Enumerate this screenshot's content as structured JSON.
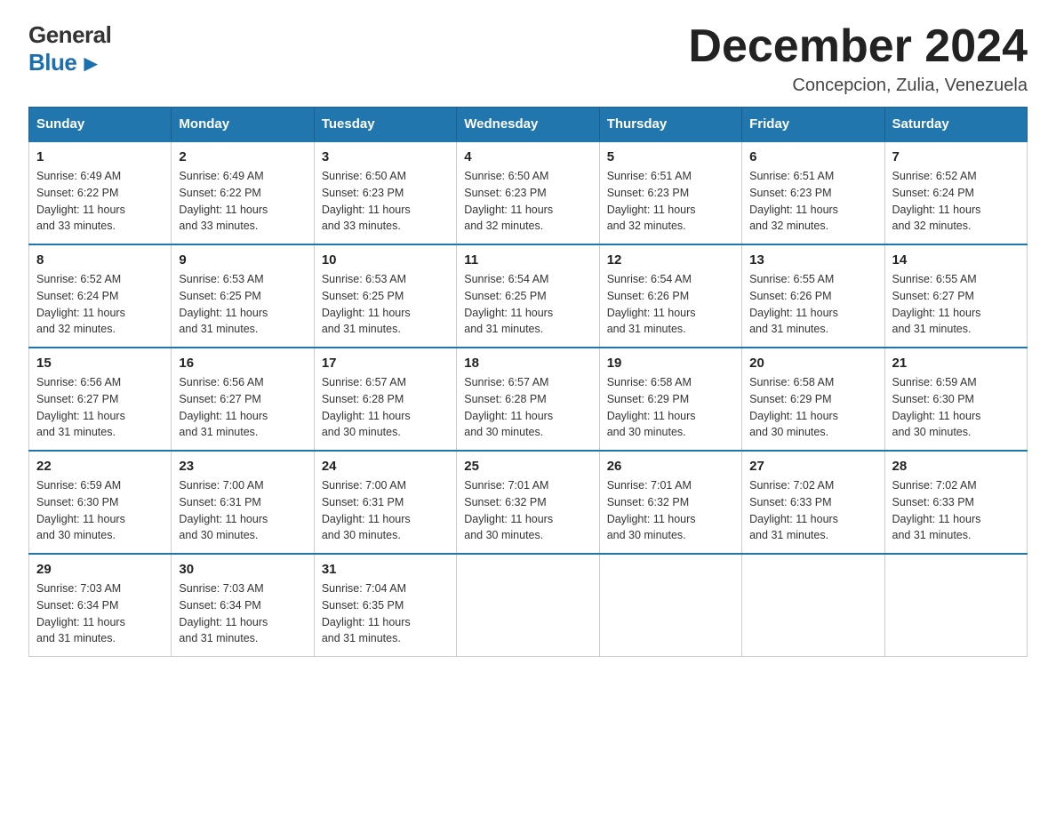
{
  "logo": {
    "general": "General",
    "blue": "Blue"
  },
  "header": {
    "month_year": "December 2024",
    "location": "Concepcion, Zulia, Venezuela"
  },
  "weekdays": [
    "Sunday",
    "Monday",
    "Tuesday",
    "Wednesday",
    "Thursday",
    "Friday",
    "Saturday"
  ],
  "weeks": [
    [
      {
        "day": "1",
        "sunrise": "6:49 AM",
        "sunset": "6:22 PM",
        "daylight": "11 hours and 33 minutes."
      },
      {
        "day": "2",
        "sunrise": "6:49 AM",
        "sunset": "6:22 PM",
        "daylight": "11 hours and 33 minutes."
      },
      {
        "day": "3",
        "sunrise": "6:50 AM",
        "sunset": "6:23 PM",
        "daylight": "11 hours and 33 minutes."
      },
      {
        "day": "4",
        "sunrise": "6:50 AM",
        "sunset": "6:23 PM",
        "daylight": "11 hours and 32 minutes."
      },
      {
        "day": "5",
        "sunrise": "6:51 AM",
        "sunset": "6:23 PM",
        "daylight": "11 hours and 32 minutes."
      },
      {
        "day": "6",
        "sunrise": "6:51 AM",
        "sunset": "6:23 PM",
        "daylight": "11 hours and 32 minutes."
      },
      {
        "day": "7",
        "sunrise": "6:52 AM",
        "sunset": "6:24 PM",
        "daylight": "11 hours and 32 minutes."
      }
    ],
    [
      {
        "day": "8",
        "sunrise": "6:52 AM",
        "sunset": "6:24 PM",
        "daylight": "11 hours and 32 minutes."
      },
      {
        "day": "9",
        "sunrise": "6:53 AM",
        "sunset": "6:25 PM",
        "daylight": "11 hours and 31 minutes."
      },
      {
        "day": "10",
        "sunrise": "6:53 AM",
        "sunset": "6:25 PM",
        "daylight": "11 hours and 31 minutes."
      },
      {
        "day": "11",
        "sunrise": "6:54 AM",
        "sunset": "6:25 PM",
        "daylight": "11 hours and 31 minutes."
      },
      {
        "day": "12",
        "sunrise": "6:54 AM",
        "sunset": "6:26 PM",
        "daylight": "11 hours and 31 minutes."
      },
      {
        "day": "13",
        "sunrise": "6:55 AM",
        "sunset": "6:26 PM",
        "daylight": "11 hours and 31 minutes."
      },
      {
        "day": "14",
        "sunrise": "6:55 AM",
        "sunset": "6:27 PM",
        "daylight": "11 hours and 31 minutes."
      }
    ],
    [
      {
        "day": "15",
        "sunrise": "6:56 AM",
        "sunset": "6:27 PM",
        "daylight": "11 hours and 31 minutes."
      },
      {
        "day": "16",
        "sunrise": "6:56 AM",
        "sunset": "6:27 PM",
        "daylight": "11 hours and 31 minutes."
      },
      {
        "day": "17",
        "sunrise": "6:57 AM",
        "sunset": "6:28 PM",
        "daylight": "11 hours and 30 minutes."
      },
      {
        "day": "18",
        "sunrise": "6:57 AM",
        "sunset": "6:28 PM",
        "daylight": "11 hours and 30 minutes."
      },
      {
        "day": "19",
        "sunrise": "6:58 AM",
        "sunset": "6:29 PM",
        "daylight": "11 hours and 30 minutes."
      },
      {
        "day": "20",
        "sunrise": "6:58 AM",
        "sunset": "6:29 PM",
        "daylight": "11 hours and 30 minutes."
      },
      {
        "day": "21",
        "sunrise": "6:59 AM",
        "sunset": "6:30 PM",
        "daylight": "11 hours and 30 minutes."
      }
    ],
    [
      {
        "day": "22",
        "sunrise": "6:59 AM",
        "sunset": "6:30 PM",
        "daylight": "11 hours and 30 minutes."
      },
      {
        "day": "23",
        "sunrise": "7:00 AM",
        "sunset": "6:31 PM",
        "daylight": "11 hours and 30 minutes."
      },
      {
        "day": "24",
        "sunrise": "7:00 AM",
        "sunset": "6:31 PM",
        "daylight": "11 hours and 30 minutes."
      },
      {
        "day": "25",
        "sunrise": "7:01 AM",
        "sunset": "6:32 PM",
        "daylight": "11 hours and 30 minutes."
      },
      {
        "day": "26",
        "sunrise": "7:01 AM",
        "sunset": "6:32 PM",
        "daylight": "11 hours and 30 minutes."
      },
      {
        "day": "27",
        "sunrise": "7:02 AM",
        "sunset": "6:33 PM",
        "daylight": "11 hours and 31 minutes."
      },
      {
        "day": "28",
        "sunrise": "7:02 AM",
        "sunset": "6:33 PM",
        "daylight": "11 hours and 31 minutes."
      }
    ],
    [
      {
        "day": "29",
        "sunrise": "7:03 AM",
        "sunset": "6:34 PM",
        "daylight": "11 hours and 31 minutes."
      },
      {
        "day": "30",
        "sunrise": "7:03 AM",
        "sunset": "6:34 PM",
        "daylight": "11 hours and 31 minutes."
      },
      {
        "day": "31",
        "sunrise": "7:04 AM",
        "sunset": "6:35 PM",
        "daylight": "11 hours and 31 minutes."
      },
      null,
      null,
      null,
      null
    ]
  ],
  "labels": {
    "sunrise": "Sunrise:",
    "sunset": "Sunset:",
    "daylight": "Daylight:"
  }
}
